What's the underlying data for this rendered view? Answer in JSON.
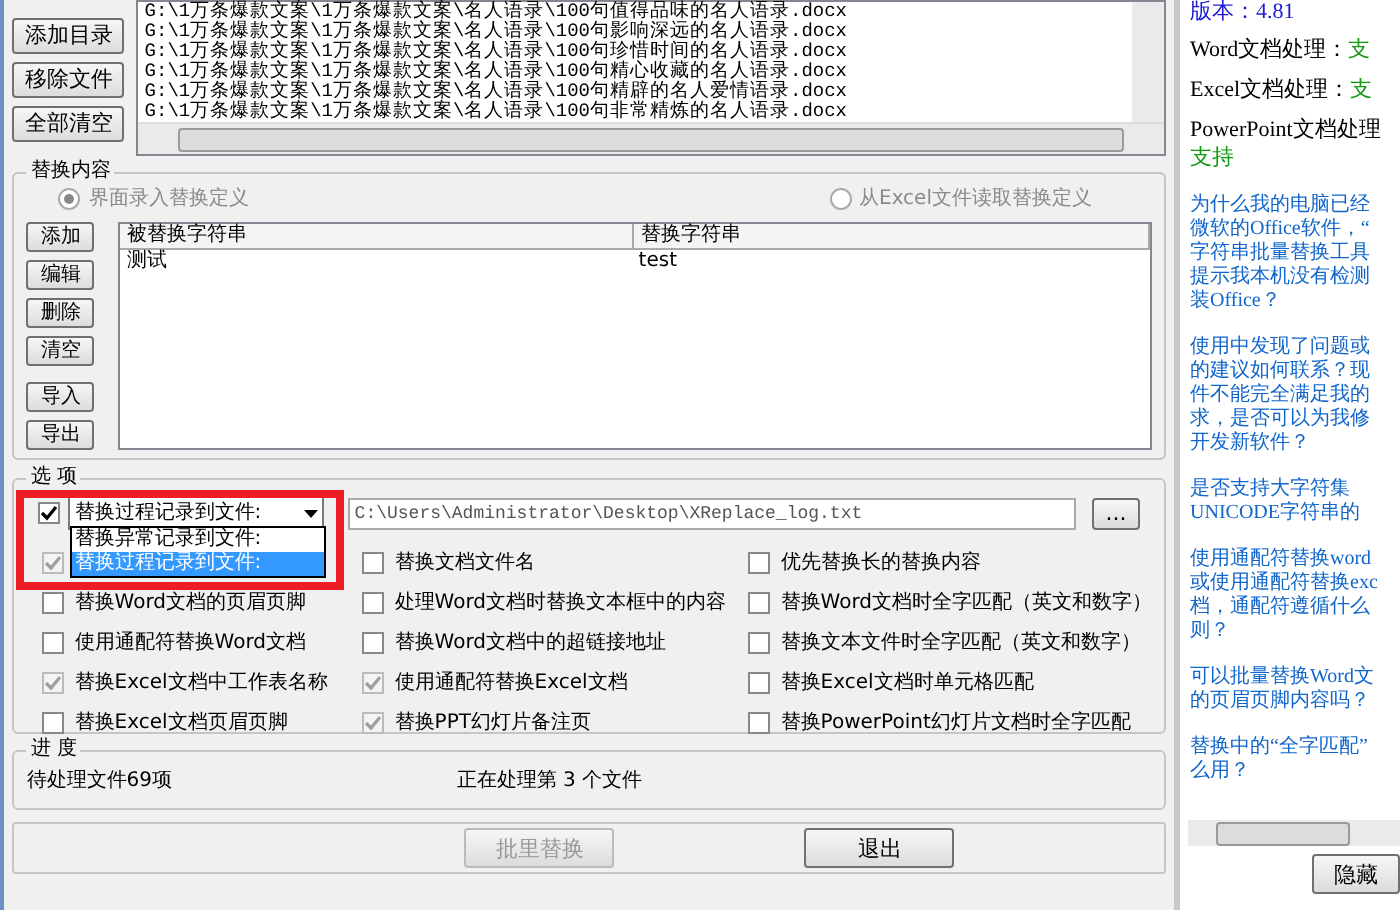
{
  "file_buttons": [
    "添加目录",
    "移除文件",
    "全部清空"
  ],
  "file_list": [
    "G:\\1万条爆款文案\\1万条爆款文案\\名人语录\\100句值得品味的名人语录.docx",
    "G:\\1万条爆款文案\\1万条爆款文案\\名人语录\\100句影响深远的名人语录.docx",
    "G:\\1万条爆款文案\\1万条爆款文案\\名人语录\\100句珍惜时间的名人语录.docx",
    "G:\\1万条爆款文案\\1万条爆款文案\\名人语录\\100句精心收藏的名人语录.docx",
    "G:\\1万条爆款文案\\1万条爆款文案\\名人语录\\100句精辟的名人爱情语录.docx",
    "G:\\1万条爆款文案\\1万条爆款文案\\名人语录\\100句非常精炼的名人语录.docx"
  ],
  "replace_group": {
    "title": "替换内容",
    "sources": [
      {
        "label": "界面录入替换定义",
        "selected": true,
        "disabled": true
      },
      {
        "label": "从Excel文件读取替换定义",
        "selected": false,
        "disabled": true
      }
    ]
  },
  "replace_buttons": [
    "添加",
    "编辑",
    "删除",
    "清空",
    "导入",
    "导出"
  ],
  "table": {
    "columns": [
      "被替换字符串",
      "替换字符串"
    ],
    "rows": [
      [
        "测试",
        "test"
      ]
    ]
  },
  "options": {
    "title": "选 项",
    "log": {
      "checked": true,
      "value": "替换过程记录到文件:",
      "expanded": true,
      "choices": [
        {
          "label": "替换异常记录到文件:",
          "selected": false
        },
        {
          "label": "替换过程记录到文件:",
          "selected": true
        }
      ],
      "path": "C:\\Users\\Administrator\\Desktop\\XReplace_log.txt",
      "browse": "..."
    },
    "checkboxes": [
      {
        "checked": true,
        "disabled": true
      },
      {
        "label": "替换文档文件名",
        "checked": false,
        "disabled": false
      },
      {
        "label": "优先替换长的替换内容",
        "checked": false,
        "disabled": false
      },
      {
        "label": "替换Word文档的页眉页脚",
        "checked": false,
        "disabled": false
      },
      {
        "label": "处理Word文档时替换文本框中的内容",
        "checked": false,
        "disabled": false
      },
      {
        "label": "替换Word文档时全字匹配（英文和数字）",
        "checked": false,
        "disabled": false
      },
      {
        "label": "使用通配符替换Word文档",
        "checked": false,
        "disabled": false
      },
      {
        "label": "替换Word文档中的超链接地址",
        "checked": false,
        "disabled": false
      },
      {
        "label": "替换文本文件时全字匹配（英文和数字）",
        "checked": false,
        "disabled": false
      },
      {
        "label": "替换Excel文档中工作表名称",
        "checked": true,
        "disabled": true
      },
      {
        "label": "使用通配符替换Excel文档",
        "checked": true,
        "disabled": true
      },
      {
        "label": "替换Excel文档时单元格匹配",
        "checked": false,
        "disabled": false
      },
      {
        "label": "替换Excel文档页眉页脚",
        "checked": false,
        "disabled": false
      },
      {
        "label": "替换PPT幻灯片备注页",
        "checked": true,
        "disabled": true
      },
      {
        "label": "替换PowerPoint幻灯片文档时全字匹配",
        "checked": false,
        "disabled": false
      }
    ]
  },
  "progress": {
    "title": "进 度",
    "pending": "待处理文件69项",
    "status": "正在处理第 3 个文件"
  },
  "actions": [
    {
      "label": "批里替换",
      "disabled": true
    },
    {
      "label": "退出",
      "disabled": false
    }
  ],
  "info": {
    "version": "版本：4.81",
    "support": [
      {
        "label": "Word文档处理：",
        "value": "支"
      },
      {
        "label": "Excel文档处理：",
        "value": "支"
      },
      {
        "label": "PowerPoint文档处理",
        "value": "支持"
      }
    ],
    "faqs": [
      [
        "为什么我的电脑已经",
        "微软的Office软件，“",
        "字符串批量替换工具",
        "提示我本机没有检测",
        "装Office？"
      ],
      [
        "使用中发现了问题或",
        "的建议如何联系？现",
        "件不能完全满足我的",
        "求，是否可以为我修",
        "开发新软件？"
      ],
      [
        "是否支持大字符集",
        "UNICODE字符串的"
      ],
      [
        "使用通配符替换word",
        "或使用通配符替换exc",
        "档，通配符遵循什么",
        "则？"
      ],
      [
        "可以批量替换Word文",
        "的页眉页脚内容吗？"
      ],
      [
        "替换中的“全字匹配”",
        "么用？"
      ]
    ],
    "hide_button": "隐藏"
  }
}
